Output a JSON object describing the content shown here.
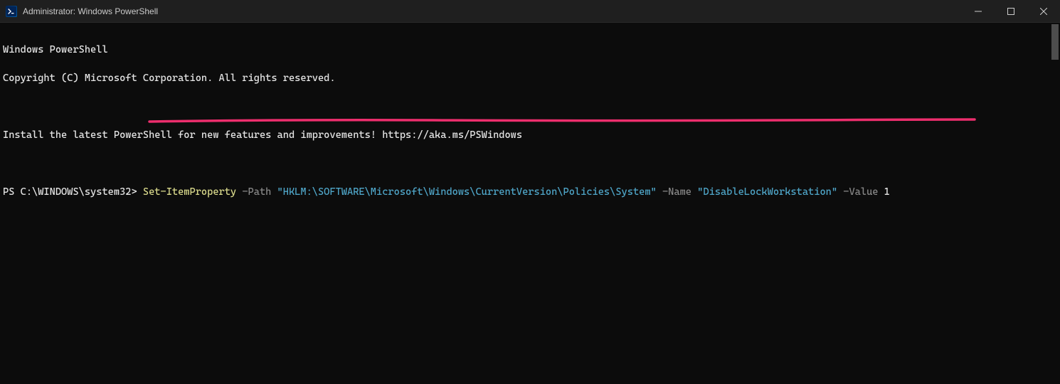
{
  "window": {
    "title": "Administrator: Windows PowerShell"
  },
  "terminal": {
    "line1": "Windows PowerShell",
    "line2": "Copyright (C) Microsoft Corporation. All rights reserved.",
    "line3": "",
    "line4": "Install the latest PowerShell for new features and improvements! https://aka.ms/PSWindows",
    "line5": "",
    "prompt": "PS C:\\WINDOWS\\system32> ",
    "cmd": "Set-ItemProperty",
    "sp1": " ",
    "param_path": "-Path",
    "sp2": " ",
    "str_path": "\"HKLM:\\SOFTWARE\\Microsoft\\Windows\\CurrentVersion\\Policies\\System\"",
    "sp3": " ",
    "param_name": "-Name",
    "sp4": " ",
    "str_name": "\"DisableLockWorkstation\"",
    "sp5": " ",
    "param_value": "-Value",
    "sp6": " ",
    "val": "1",
    "ps_icon_text": ">_"
  },
  "annotation": {
    "color": "#ed2e6d"
  }
}
